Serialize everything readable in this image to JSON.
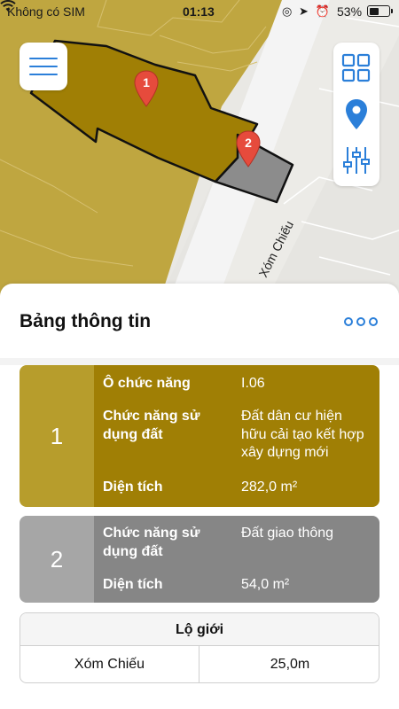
{
  "status_bar": {
    "carrier": "Không có SIM",
    "time": "01:13",
    "battery": "53%",
    "battery_level": 0.53
  },
  "map": {
    "street_name": "Xóm Chiếu",
    "markers": [
      {
        "label": "1"
      },
      {
        "label": "2"
      }
    ],
    "colors": {
      "zone_residential": "#a07f05",
      "zone_traffic": "#8c8c8c",
      "road": "#f2f2f2",
      "marker": "#e64b3c"
    },
    "buttons": {
      "menu": "menu-icon",
      "layers": "grid-icon",
      "location": "location-pin-icon",
      "filter": "sliders-icon"
    }
  },
  "sheet": {
    "title": "Bảng thông tin",
    "more_icon": "more-icon",
    "parcels": [
      {
        "index": "1",
        "color": "#a07f05",
        "rows": [
          {
            "label": "Ô chức năng",
            "value": "I.06"
          },
          {
            "label": "Chức năng sử dụng đất",
            "value": "Đất dân cư hiện hữu cải tạo kết hợp xây dựng mới"
          },
          {
            "label": "Diện tích",
            "value": "282,0 m²"
          }
        ]
      },
      {
        "index": "2",
        "color": "#868686",
        "rows": [
          {
            "label": "Chức năng sử dụng đất",
            "value": "Đất giao thông"
          },
          {
            "label": "Diện tích",
            "value": "54,0 m²"
          }
        ]
      }
    ],
    "lo_gioi": {
      "title": "Lộ giới",
      "street": "Xóm Chiếu",
      "width": "25,0m"
    }
  }
}
